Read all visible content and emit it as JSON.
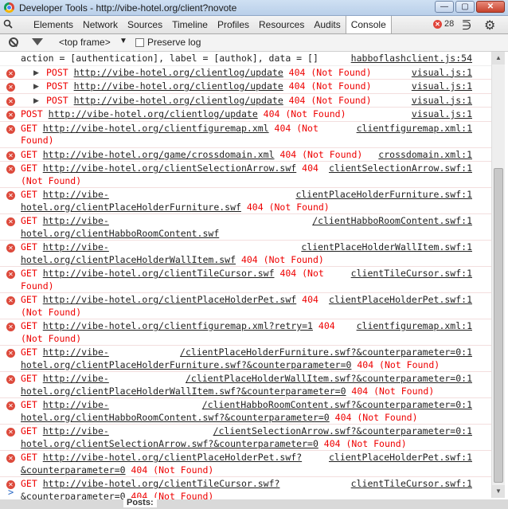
{
  "window": {
    "title": "Developer Tools - http://vibe-hotel.org/client?novote"
  },
  "tabs": [
    "Elements",
    "Network",
    "Sources",
    "Timeline",
    "Profiles",
    "Resources",
    "Audits",
    "Console"
  ],
  "error_count": "28",
  "console_toolbar": {
    "frame": "<top frame>",
    "preserve_log": "Preserve log"
  },
  "messages": [
    {
      "type": "info",
      "text": "action = [authentication], label = [authok], data = []",
      "src": "habboflashclient.js:54"
    },
    {
      "type": "sub",
      "method": "POST",
      "url": "http://vibe-hotel.org/clientlog/update",
      "status": " 404 (Not Found)",
      "src": "visual.js:1"
    },
    {
      "type": "sub",
      "method": "POST",
      "url": "http://vibe-hotel.org/clientlog/update",
      "status": " 404 (Not Found)",
      "src": "visual.js:1"
    },
    {
      "type": "sub",
      "method": "POST",
      "url": "http://vibe-hotel.org/clientlog/update",
      "status": " 404 (Not Found)",
      "src": "visual.js:1"
    },
    {
      "type": "err",
      "method": "POST",
      "url": "http://vibe-hotel.org/clientlog/update",
      "status": " 404 (Not Found)",
      "src": "visual.js:1"
    },
    {
      "type": "err",
      "method": "GET",
      "url": "http://vibe-hotel.org/clientfiguremap.xml",
      "status": " 404 (Not Found)",
      "src": "clientfiguremap.xml:1"
    },
    {
      "type": "err",
      "method": "GET",
      "url": "http://vibe-hotel.org/game/crossdomain.xml",
      "status": " 404 (Not Found)",
      "src": "crossdomain.xml:1"
    },
    {
      "type": "err",
      "method": "GET",
      "url": "http://vibe-hotel.org/clientSelectionArrow.swf",
      "status": " 404 (Not Found)",
      "src": "clientSelectionArrow.swf:1"
    },
    {
      "type": "err",
      "method": "GET",
      "url": "http://vibe-hotel.org/clientPlaceHolderFurniture.swf",
      "status": " 404 (Not Found)",
      "src": "clientPlaceHolderFurniture.swf:1"
    },
    {
      "type": "err",
      "method": "GET",
      "url": "http://vibe-hotel.org/clientHabboRoomContent.swf",
      "status": "",
      "src": "/clientHabboRoomContent.swf:1"
    },
    {
      "type": "err",
      "method": "GET",
      "url": "http://vibe-hotel.org/clientPlaceHolderWallItem.swf",
      "status": " 404 (Not Found)",
      "src": "clientPlaceHolderWallItem.swf:1"
    },
    {
      "type": "err",
      "method": "GET",
      "url": "http://vibe-hotel.org/clientTileCursor.swf",
      "status": " 404 (Not Found)",
      "src": "clientTileCursor.swf:1"
    },
    {
      "type": "err",
      "method": "GET",
      "url": "http://vibe-hotel.org/clientPlaceHolderPet.swf",
      "status": " 404 (Not Found)",
      "src": "clientPlaceHolderPet.swf:1"
    },
    {
      "type": "err",
      "method": "GET",
      "url": "http://vibe-hotel.org/clientfiguremap.xml?retry=1",
      "status": " 404 (Not Found)",
      "src": "clientfiguremap.xml:1"
    },
    {
      "type": "err",
      "method": "GET",
      "url": "http://vibe-hotel.org/clientPlaceHolderFurniture.swf?&counterparameter=0",
      "status": " 404 (Not Found)",
      "src": "/clientPlaceHolderFurniture.swf?&counterparameter=0:1"
    },
    {
      "type": "err",
      "method": "GET",
      "url": "http://vibe-hotel.org/clientPlaceHolderWallItem.swf?&counterparameter=0",
      "status": " 404 (Not Found)",
      "src": "/clientPlaceHolderWallItem.swf?&counterparameter=0:1"
    },
    {
      "type": "err",
      "method": "GET",
      "url": "http://vibe-hotel.org/clientHabboRoomContent.swf?&counterparameter=0",
      "status": " 404 (Not Found)",
      "src": "/clientHabboRoomContent.swf?&counterparameter=0:1"
    },
    {
      "type": "err",
      "method": "GET",
      "url": "http://vibe-hotel.org/clientSelectionArrow.swf?&counterparameter=0",
      "status": " 404 (Not Found)",
      "src": "/clientSelectionArrow.swf?&counterparameter=0:1"
    },
    {
      "type": "err",
      "method": "GET",
      "url": "http://vibe-hotel.org/clientPlaceHolderPet.swf?&counterparameter=0",
      "status": " 404 (Not Found)",
      "src": "clientPlaceHolderPet.swf:1"
    },
    {
      "type": "err",
      "method": "GET",
      "url": "http://vibe-hotel.org/clientTileCursor.swf?&counterparameter=0",
      "status": " 404 (Not Found)",
      "src": "clientTileCursor.swf:1"
    }
  ],
  "prompt": ">",
  "page_behind": {
    "posts": "Posts:"
  }
}
